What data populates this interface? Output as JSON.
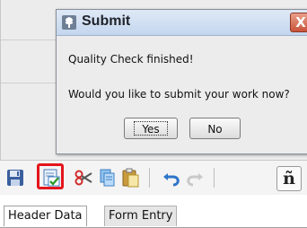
{
  "dialog": {
    "title": "Submit",
    "close_glyph": "X",
    "message_line1": "Quality Check finished!",
    "message_line2": "Would you like to submit your work now?",
    "yes_label": "Yes",
    "no_label": "No",
    "icon": "tree-app-icon"
  },
  "toolbar": {
    "icons": [
      "save-icon",
      "quality-check-icon",
      "cut-icon",
      "copy-icon",
      "paste-icon",
      "undo-icon",
      "redo-icon"
    ],
    "highlighted_icon": "quality-check-icon",
    "highlight_color": "#e4151c",
    "tilde_label": "ñ"
  },
  "tabs": [
    {
      "label": "Header Data",
      "active": true
    },
    {
      "label": "Form Entry",
      "active": false
    }
  ]
}
